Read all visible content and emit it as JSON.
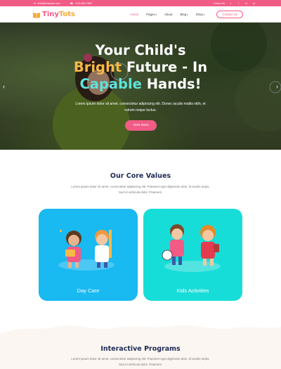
{
  "topbar": {
    "email": "hello@example.com",
    "phone": "+123-456-7890",
    "follow_label": "Follow Us",
    "socials": [
      "f",
      "t",
      "in",
      "yt"
    ]
  },
  "brand": {
    "name_part1": "Tiny",
    "name_part2": "Tots"
  },
  "nav": {
    "items": [
      {
        "label": "Home"
      },
      {
        "label": "Pages"
      },
      {
        "label": "About"
      },
      {
        "label": "Blog"
      },
      {
        "label": "Shop"
      }
    ],
    "contact_label": "Contact Us"
  },
  "hero": {
    "title_line1": "Your Child's",
    "title_bright": "Bright",
    "title_line2_rest": " Future - In",
    "title_capable": "Capable",
    "title_line3_rest": " Hands!",
    "text": "Lorem ipsum dolor sit amet, consectetur adipiscing elit. Donec iaculis mattis nibh, et rutrum neque luctus.",
    "button": "View More",
    "prev_arrow": "‹",
    "next_arrow": "›"
  },
  "core_values": {
    "title": "Our Core Values",
    "text": "Lorem ipsum dolor sit amet, consectetur adipiscing elit. Praesent eget dignissim ante, id iaculis turpis. Sed et vehicula dolor. Praesent.",
    "cards": [
      {
        "label": "Day Care"
      },
      {
        "label": "Kids Activities"
      }
    ]
  },
  "interactive": {
    "title": "Interactive Programs",
    "text": "Lorem ipsum dolor sit amet, consectetur adipiscing elit. Praesent eget dignissim ante, id iaculis turpis. Sed et vehicula dolor. Praesent."
  },
  "colors": {
    "primary_pink": "#f15b86",
    "accent_yellow": "#f7b948",
    "accent_teal": "#5ee3dc",
    "card_blue": "#19b9f2",
    "card_teal": "#17ddd9",
    "heading_navy": "#1e2a55"
  }
}
